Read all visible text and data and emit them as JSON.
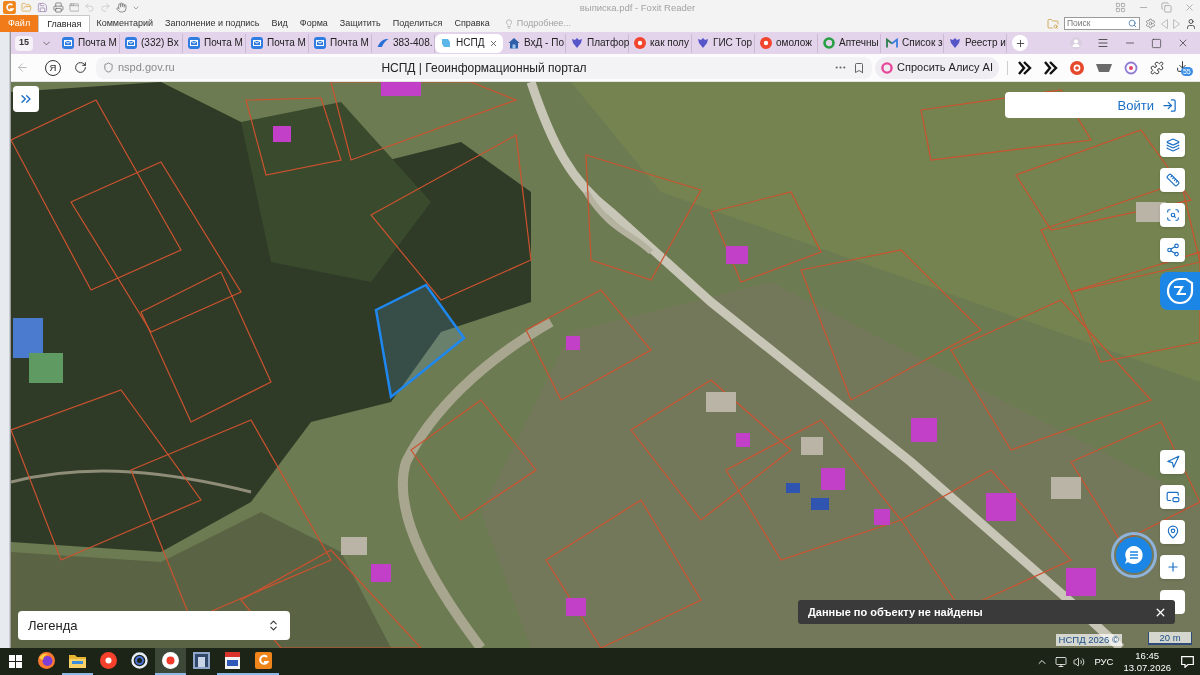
{
  "foxit": {
    "title": "выписка.pdf - Foxit Reader",
    "ribbon_tabs": [
      {
        "label": "Файл",
        "kind": "file",
        "selected": false
      },
      {
        "label": "Главная",
        "kind": "tab",
        "selected": true
      },
      {
        "label": "Комментарий",
        "kind": "tab",
        "selected": false
      },
      {
        "label": "Заполнение и подпись",
        "kind": "tab",
        "selected": false
      },
      {
        "label": "Вид",
        "kind": "tab",
        "selected": false
      },
      {
        "label": "Форма",
        "kind": "tab",
        "selected": false
      },
      {
        "label": "Защитить",
        "kind": "tab",
        "selected": false
      },
      {
        "label": "Поделиться",
        "kind": "tab",
        "selected": false
      },
      {
        "label": "Справка",
        "kind": "tab",
        "selected": false
      }
    ],
    "tell_me": "Подробнее...",
    "search": {
      "placeholder": "Поиск"
    }
  },
  "browser": {
    "tab_count": "15",
    "tabs": [
      {
        "title": "Почта М",
        "kind": "mail",
        "selected": false
      },
      {
        "title": "(332) Вх",
        "kind": "mail",
        "selected": false
      },
      {
        "title": "Почта М",
        "kind": "mail",
        "selected": false
      },
      {
        "title": "Почта М",
        "kind": "mail",
        "selected": false
      },
      {
        "title": "Почта М",
        "kind": "mail",
        "selected": false
      },
      {
        "title": "383-408.",
        "kind": "cloud",
        "selected": false
      },
      {
        "title": "НСПД",
        "kind": "site",
        "selected": true
      },
      {
        "title": "ВхД - По",
        "kind": "building",
        "selected": false
      },
      {
        "title": "Платфор",
        "kind": "emblem",
        "selected": false
      },
      {
        "title": "как полу",
        "kind": "yandex",
        "selected": false
      },
      {
        "title": "ГИС Тор",
        "kind": "emblem",
        "selected": false
      },
      {
        "title": "омолож",
        "kind": "yandex",
        "selected": false
      },
      {
        "title": "Аптечны",
        "kind": "pharmacy",
        "selected": false
      },
      {
        "title": "Список з",
        "kind": "gmail",
        "selected": false
      },
      {
        "title": "Реестр и",
        "kind": "emblem",
        "selected": false
      }
    ],
    "address": {
      "home_glyph": "Я",
      "url": "nspd.gov.ru",
      "page_title": "НСПД | Геоинформационный портал",
      "alice_button": "Спросить Алису AI",
      "downloads_badge": "55"
    }
  },
  "map": {
    "login_button": "Войти",
    "legend": "Легенда",
    "notice": "Данные по объекту не найдены",
    "attribution": "НСПД 2026 ©",
    "scale": "20 m"
  },
  "taskbar": {
    "apps": [
      {
        "kind": "firefox",
        "selected": false,
        "running": false
      },
      {
        "kind": "folder",
        "selected": false,
        "running": true
      },
      {
        "kind": "yandex",
        "selected": false,
        "running": false
      },
      {
        "kind": "ring",
        "selected": false,
        "running": false
      },
      {
        "kind": "ybrowser",
        "selected": true,
        "running": true
      },
      {
        "kind": "picture",
        "selected": false,
        "running": false
      },
      {
        "kind": "pdf",
        "selected": false,
        "running": true
      },
      {
        "kind": "foxit",
        "selected": false,
        "running": true
      }
    ],
    "language": "РУС",
    "time": "16:45",
    "date": "13.07.2026"
  }
}
